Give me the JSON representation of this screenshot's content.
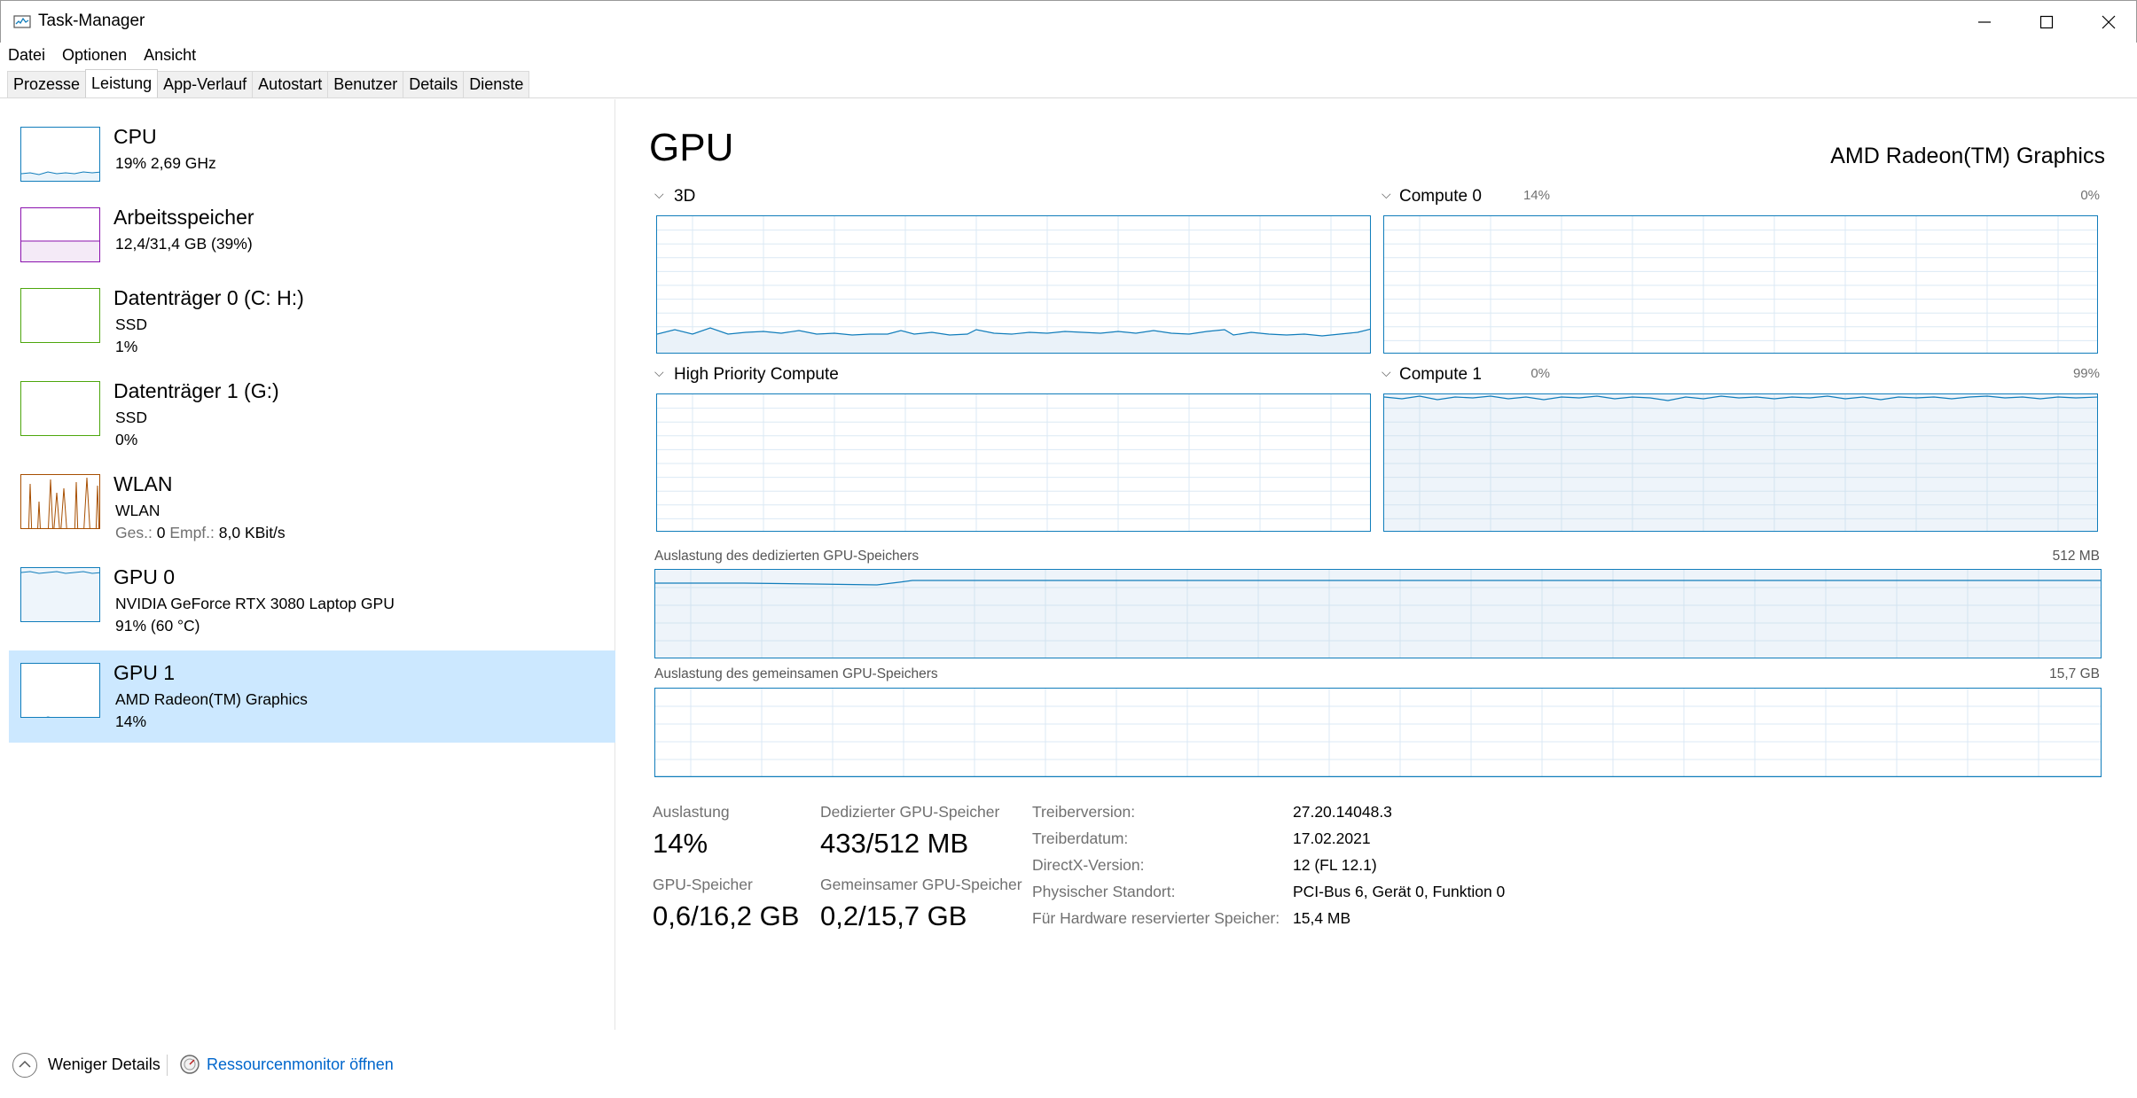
{
  "window": {
    "title": "Task-Manager"
  },
  "menu": [
    "Datei",
    "Optionen",
    "Ansicht"
  ],
  "tabs": [
    "Prozesse",
    "Leistung",
    "App-Verlauf",
    "Autostart",
    "Benutzer",
    "Details",
    "Dienste"
  ],
  "active_tab": "Leistung",
  "sidebar": [
    {
      "title": "CPU",
      "line1": "19%  2,69 GHz",
      "line2": ""
    },
    {
      "title": "Arbeitsspeicher",
      "line1": "12,4/31,4 GB (39%)",
      "line2": ""
    },
    {
      "title": "Datenträger 0 (C: H:)",
      "line1": "SSD",
      "line2": "1%"
    },
    {
      "title": "Datenträger 1 (G:)",
      "line1": "SSD",
      "line2": "0%"
    },
    {
      "title": "WLAN",
      "line1": "WLAN",
      "line2_label1": "Ges.:",
      "line2_val1": "0",
      "line2_label2": "Empf.:",
      "line2_val2": "8,0 KBit/s"
    },
    {
      "title": "GPU 0",
      "line1": "NVIDIA GeForce RTX 3080 Laptop GPU",
      "line2": "91%  (60 °C)"
    },
    {
      "title": "GPU 1",
      "line1": "AMD Radeon(TM) Graphics",
      "line2": "14%"
    }
  ],
  "main": {
    "title": "GPU",
    "device": "AMD Radeon(TM) Graphics",
    "engines": [
      {
        "label": "3D",
        "pct": "14%"
      },
      {
        "label": "Compute 0",
        "pct": "0%"
      },
      {
        "label": "High Priority Compute",
        "pct": "0%"
      },
      {
        "label": "Compute 1",
        "pct": "99%"
      }
    ],
    "dedicated_label": "Auslastung des dedizierten GPU-Speichers",
    "dedicated_max": "512 MB",
    "shared_label": "Auslastung des gemeinsamen GPU-Speichers",
    "shared_max": "15,7 GB",
    "stats": {
      "util_label": "Auslastung",
      "util_value": "14%",
      "ded_label": "Dedizierter GPU-Speicher",
      "ded_value": "433/512 MB",
      "gpu_mem_label": "GPU-Speicher",
      "gpu_mem_value": "0,6/16,2 GB",
      "shared_mem_label": "Gemeinsamer GPU-Speicher",
      "shared_mem_value": "0,2/15,7 GB"
    },
    "info": [
      {
        "label": "Treiberversion:",
        "value": "27.20.14048.3"
      },
      {
        "label": "Treiberdatum:",
        "value": "17.02.2021"
      },
      {
        "label": "DirectX-Version:",
        "value": "12 (FL 12.1)"
      },
      {
        "label": "Physischer Standort:",
        "value": "PCI-Bus 6, Gerät 0, Funktion 0"
      },
      {
        "label": "Für Hardware reservierter Speicher:",
        "value": "15,4 MB"
      }
    ]
  },
  "footer": {
    "fewer_details": "Weniger Details",
    "resource_monitor": "Ressourcenmonitor öffnen"
  },
  "colors": {
    "accent_blue": "#117dbb",
    "memory_purple": "#8b12ae",
    "disk_green": "#4da60c",
    "wlan_orange": "#a74f01",
    "selected_bg": "#cce8ff",
    "link": "#0066cc"
  },
  "icons": {
    "app": "task-manager-icon",
    "minimize": "minimize-icon",
    "maximize": "maximize-icon",
    "close": "close-icon",
    "collapse": "chevron-up-circle-icon",
    "resmon": "resource-monitor-icon"
  }
}
